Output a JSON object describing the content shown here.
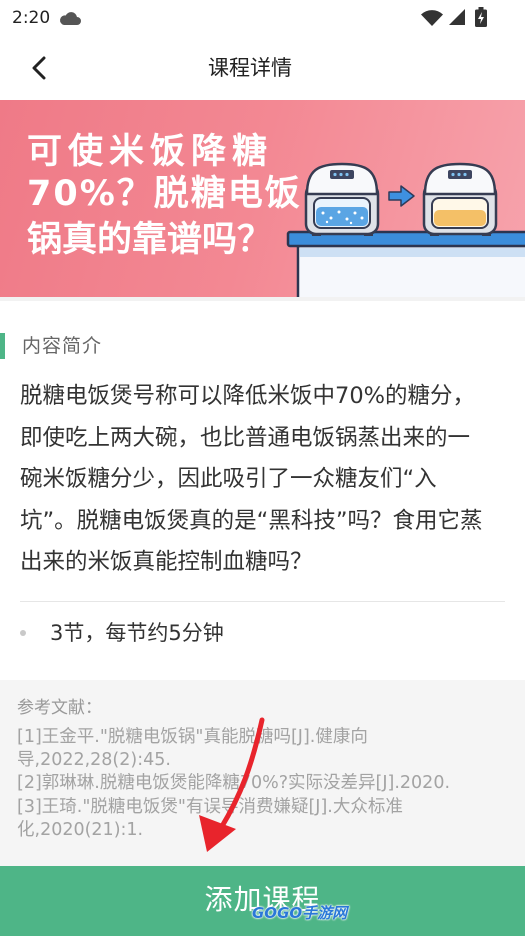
{
  "status_bar": {
    "time": "2:20",
    "icons": [
      "cloud-icon",
      "wifi-icon",
      "signal-icon",
      "battery-charging-icon"
    ]
  },
  "header": {
    "title": "课程详情",
    "back_icon": "chevron-left-icon"
  },
  "banner": {
    "headline_lines": [
      "可使米饭降糖",
      "70%？脱糖电饭",
      "锅真的靠谱吗？"
    ],
    "illustration_icons": [
      "rice-cooker-icon",
      "arrow-right-icon",
      "rice-cooker-icon"
    ]
  },
  "intro": {
    "section_title": "内容简介",
    "description_lines": [
      "脱糖电饭煲号称可以降低米饭中70%的糖分，",
      "即使吃上两大碗，也比普通电饭锅蒸出来的一",
      "碗米饭糖分少，因此吸引了一众糖友们“入",
      "坑”。脱糖电饭煲真的是“黑科技”吗？食用它蒸",
      "出来的米饭真能控制血糖吗？"
    ],
    "lesson_info": "3节，每节约5分钟"
  },
  "references": {
    "title": "参考文献：",
    "lines": [
      "[1]王金平.\"脱糖电饭锅\"真能脱糖吗[J].健康向",
      "导,2022,28(2):45.",
      "[2]郭琳琳.脱糖电饭煲能降糖70%?实际没差异[J].2020.",
      "[3]王琦.\"脱糖电饭煲\"有误导消费嫌疑[J].大众标准",
      "化,2020(21):1."
    ]
  },
  "footer": {
    "add_course_label": "添加课程"
  },
  "watermark": {
    "text": "GOGO手游网"
  },
  "colors": {
    "accent_green": "#4eb587",
    "banner_pink": "#f17f8b",
    "text_primary": "#333333",
    "text_secondary": "#999999",
    "annotation_red": "#e8242c"
  }
}
